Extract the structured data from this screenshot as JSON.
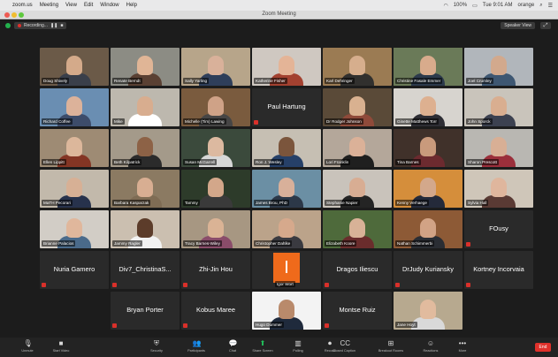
{
  "menubar": {
    "apple": "",
    "items": [
      "zoom.us",
      "Meeting",
      "View",
      "Edit",
      "Window",
      "Help"
    ],
    "right": [
      "100%",
      "Tue 9:01 AM",
      "orange"
    ]
  },
  "window": {
    "title": "Zoom Meeting"
  },
  "topbar": {
    "recording": "Recording...",
    "view": "Speaker View",
    "fullscreen": "⤢"
  },
  "colors": {
    "accent_green": "#23b14d",
    "end_red": "#e0312b",
    "active_border": "#e7d84a",
    "muted_red": "#d9302a"
  },
  "tiles": [
    {
      "name": "Doug Shively",
      "bg": "#6b5a48",
      "skin": "#d4aa8a",
      "shirt": "#3a3f4a"
    },
    {
      "name": "Renate Berndt",
      "bg": "#8c8c84",
      "skin": "#e0b596",
      "shirt": "#5a4033"
    },
    {
      "name": "Sally Yarling",
      "bg": "#b7a58a",
      "skin": "#d9b19a",
      "shirt": "#2e3e5a"
    },
    {
      "name": "Katherine Fisher",
      "bg": "#cfc8c1",
      "skin": "#e4b497",
      "shirt": "#a34130"
    },
    {
      "name": "Karl Dehringer",
      "bg": "#9b7b53",
      "skin": "#d6ae8d",
      "shirt": "#31302e"
    },
    {
      "name": "Christine Fasale Emmer",
      "bg": "#6a7a58",
      "skin": "#d8ab8c",
      "shirt": "#2c3a4c",
      "active": true
    },
    {
      "name": "Joel Crumley",
      "bg": "#b1b6bb",
      "skin": "#d2a98d",
      "shirt": "#3e5772"
    },
    {
      "name": "Richard Coffee",
      "bg": "#6a8eb2",
      "skin": "#dcb29a",
      "shirt": "#3d4c6a"
    },
    {
      "name": "Mike",
      "bg": "#bdb8ae",
      "skin": "#d8ad8f",
      "shirt": "#ffffff"
    },
    {
      "name": "Michelle (Tim) Lawing",
      "bg": "#7a5b3e",
      "skin": "#cfa287",
      "shirt": "#464545"
    },
    {
      "name": "Paul Hartung",
      "dark": true
    },
    {
      "name": "Dr Rodger Johnson",
      "bg": "#5a4a38",
      "skin": "#d9b190",
      "shirt": "#8f4a3a"
    },
    {
      "name": "Ginette Matthews Torr",
      "bg": "#d7d4cf",
      "skin": "#ddb090",
      "shirt": "#2d2d34"
    },
    {
      "name": "John Sporck",
      "bg": "#c9c4bb",
      "skin": "#d9ae90",
      "shirt": "#3c4150"
    },
    {
      "name": "Ellen Lippitt",
      "bg": "#9e8b74",
      "skin": "#dcb79b",
      "shirt": "#843524"
    },
    {
      "name": "Beth Kilpatrick",
      "bg": "#a49a8a",
      "skin": "#8d6246",
      "shirt": "#2b2b2b"
    },
    {
      "name": "Susan McGarrell",
      "bg": "#3b4a3c",
      "skin": "#dcb9a0",
      "shirt": "#d7d7d7"
    },
    {
      "name": "Ron J. Wesley",
      "bg": "#c6bfb3",
      "skin": "#7b553c",
      "shirt": "#264068"
    },
    {
      "name": "Lori Franklin",
      "bg": "#b4a79a",
      "skin": "#dbb198",
      "shirt": "#1f1f1f"
    },
    {
      "name": "Tina Barnes",
      "bg": "#40312a",
      "skin": "#c99a7c",
      "shirt": "#6c2a2f"
    },
    {
      "name": "Sharon Prescott",
      "bg": "#b9b7b2",
      "skin": "#d8af95",
      "shirt": "#9b2f3b"
    },
    {
      "name": "MaTH Pecorari",
      "bg": "#c2b9ab",
      "skin": "#d7b095",
      "shirt": "#27324c"
    },
    {
      "name": "Barbara Kasparzak",
      "bg": "#8b7a62",
      "skin": "#d8ae92",
      "shirt": "#7f6c54"
    },
    {
      "name": "Tammy",
      "bg": "#2d3b2a",
      "skin": "#d3a78a",
      "shirt": "#3a3a3a"
    },
    {
      "name": "James Brou, PhD",
      "bg": "#6b8fa4",
      "skin": "#d8b09a",
      "shirt": "#2c3848"
    },
    {
      "name": "Stephanie Napier",
      "bg": "#c9c3bb",
      "skin": "#d8ad93",
      "shirt": "#242424"
    },
    {
      "name": "Kenny Verhaege",
      "bg": "#d58e3b",
      "skin": "#d3a88b",
      "shirt": "#242a3a"
    },
    {
      "name": "Sylvia Hall",
      "bg": "#cfc6b9",
      "skin": "#dfb69d",
      "shirt": "#5a3a34"
    },
    {
      "name": "Brianne Palacios",
      "bg": "#d2cdc6",
      "skin": "#e0b79c",
      "shirt": "#4a6a8a"
    },
    {
      "name": "Jammy Ragler",
      "bg": "#cbbfb0",
      "skin": "#5c3c2a",
      "shirt": "#f2f2f2"
    },
    {
      "name": "Tracy Barnes-Wiley",
      "bg": "#a79782",
      "skin": "#dab395",
      "shirt": "#8a4c6a"
    },
    {
      "name": "Christopher Dahlke",
      "bg": "#bba38a",
      "skin": "#d6a98c",
      "shirt": "#3a3a40"
    },
    {
      "name": "Elizabeth Koore",
      "bg": "#4e6a3b",
      "skin": "#d8b297",
      "shirt": "#6a2c2c"
    },
    {
      "name": "Nathan Schimmerbi",
      "bg": "#8d5a36",
      "skin": "#d2a385",
      "shirt": "#2a2d33"
    },
    {
      "name": "FOusy",
      "dark": true
    },
    {
      "name": "Nuria Gamero",
      "dark": true
    },
    {
      "name": "Div7_ChristinaS...",
      "dark": true
    },
    {
      "name": "Zhi-Jin Hou",
      "dark": true
    },
    {
      "name": "Igor Wort",
      "orange": true
    },
    {
      "name": "Dragos Iliescu",
      "dark": true
    },
    {
      "name": "DrJudy Kuriansky",
      "dark": true
    },
    {
      "name": "Kortney Incorvaia",
      "dark": true
    },
    {
      "name": "Bryan Porter",
      "dark": true
    },
    {
      "name": "Kobus Maree",
      "dark": true
    },
    {
      "name": "Hugo Dummer",
      "bg": "#f3f3f3",
      "skin": "#b98a6b",
      "shirt": "#1f2a3c"
    },
    {
      "name": "Montse Ruiz",
      "dark": true
    },
    {
      "name": "Jane Hoyt",
      "bg": "#b7a98f",
      "skin": "#e1bb9e",
      "shirt": "#d9d9d9"
    }
  ],
  "toolbar": [
    {
      "label": "Unmute",
      "icon": "microphone-icon",
      "glyph": "🎙"
    },
    {
      "label": "Start Video",
      "icon": "video-camera-icon",
      "glyph": "■"
    },
    {
      "label": "Security",
      "icon": "shield-icon",
      "glyph": "⛨"
    },
    {
      "label": "Participants",
      "icon": "participants-icon",
      "glyph": "👥"
    },
    {
      "label": "Chat",
      "icon": "chat-icon",
      "glyph": "💬"
    },
    {
      "label": "Share Screen",
      "icon": "share-screen-icon",
      "glyph": "⬆"
    },
    {
      "label": "Polling",
      "icon": "polling-icon",
      "glyph": "▥"
    },
    {
      "label": "Record",
      "icon": "record-icon",
      "glyph": "⏺"
    },
    {
      "label": "Closed Caption",
      "icon": "cc-icon",
      "glyph": "CC"
    },
    {
      "label": "Breakout Rooms",
      "icon": "breakout-rooms-icon",
      "glyph": "⊞"
    },
    {
      "label": "Reactions",
      "icon": "reactions-icon",
      "glyph": "☺"
    },
    {
      "label": "More",
      "icon": "more-icon",
      "glyph": "•••"
    }
  ],
  "end_label": "End"
}
